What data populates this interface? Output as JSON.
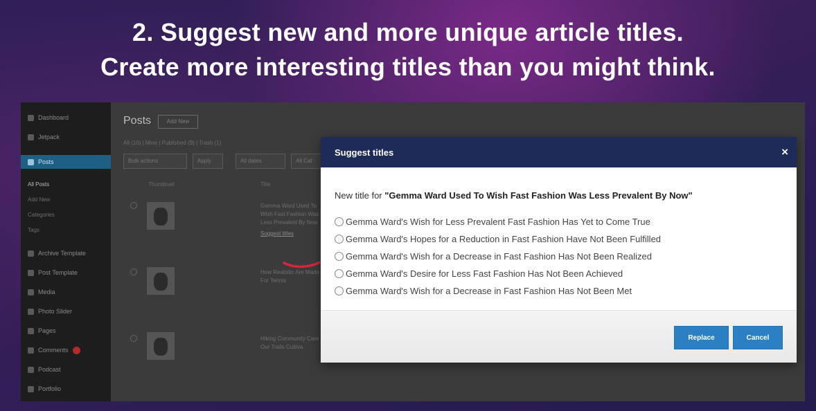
{
  "headline": {
    "line1": "2. Suggest new and more unique article titles.",
    "line2": "Create more interesting titles than you might think."
  },
  "wp": {
    "sidebar": [
      {
        "label": "Dashboard"
      },
      {
        "label": "Jetpack"
      },
      {
        "label": "Posts"
      },
      {
        "label": "All Posts"
      },
      {
        "label": "Add New"
      },
      {
        "label": "Categories"
      },
      {
        "label": "Tags"
      },
      {
        "label": "Archive Template"
      },
      {
        "label": "Post Template"
      },
      {
        "label": "Media"
      },
      {
        "label": "Photo Slider"
      },
      {
        "label": "Pages"
      },
      {
        "label": "Comments"
      },
      {
        "label": "Podcast"
      },
      {
        "label": "Portfolio"
      }
    ],
    "page_title": "Posts",
    "add_new": "Add New",
    "filters": "All (10) | Mine | Published (9) | Trash (1)",
    "bulk_actions": "Bulk actions",
    "apply": "Apply",
    "all_dates": "All dates",
    "all_categories": "All Cat",
    "col_thumbnail": "Thumbnail",
    "col_title": "Title",
    "rows": [
      {
        "title": "Gemma Ward Used To Wish Fast Fashion Was Less Prevalent By Now",
        "action": "Suggest titles"
      },
      {
        "title": "How Realistic Are Made For Tennis",
        "action": ""
      },
      {
        "title": "Hiking Community Care Our Trails Cultiva",
        "action": ""
      }
    ]
  },
  "dialog": {
    "title": "Suggest titles",
    "close": "×",
    "prompt_prefix": "New title for ",
    "prompt_title": "\"Gemma Ward Used To Wish Fast Fashion Was Less Prevalent By Now\"",
    "options": [
      "Gemma Ward's Wish for Less Prevalent Fast Fashion Has Yet to Come True",
      "Gemma Ward's Hopes for a Reduction in Fast Fashion Have Not Been Fulfilled",
      "Gemma Ward's Wish for a Decrease in Fast Fashion Has Not Been Realized",
      "Gemma Ward's Desire for Less Fast Fashion Has Not Been Achieved",
      "Gemma Ward's Wish for a Decrease in Fast Fashion Has Not Been Met"
    ],
    "replace": "Replace",
    "cancel": "Cancel"
  },
  "colors": {
    "dialog_header": "#1e2a57",
    "button": "#2b7fc3",
    "arrow": "#d6263b",
    "sidebar_active": "#1e5f86"
  }
}
